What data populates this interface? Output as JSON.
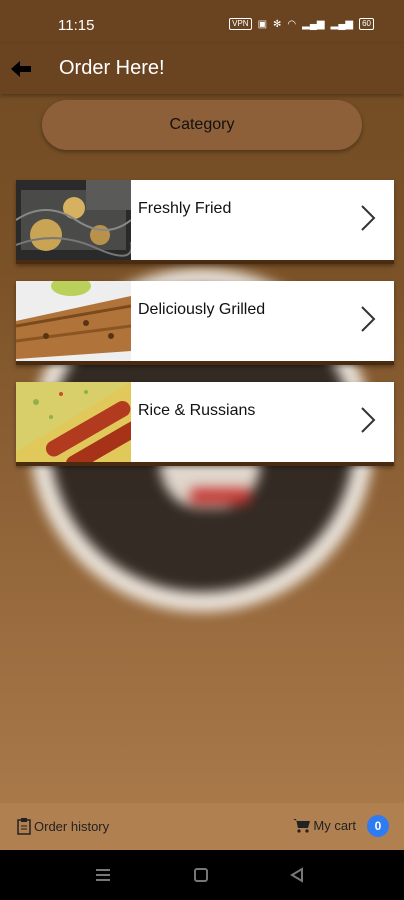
{
  "status_bar": {
    "time": "11:15",
    "vpn": "VPN",
    "battery": "60"
  },
  "app_bar": {
    "title": "Order Here!"
  },
  "category_button": {
    "label": "Category"
  },
  "categories": [
    {
      "label": "Freshly Fried",
      "image": "fryer-food-photo"
    },
    {
      "label": "Deliciously Grilled",
      "image": "grilled-fish-photo"
    },
    {
      "label": "Rice & Russians",
      "image": "rice-sausage-photo"
    }
  ],
  "bottom_bar": {
    "order_history": "Order history",
    "my_cart": "My cart",
    "cart_count": "0"
  },
  "colors": {
    "app_bar": "#6a4320",
    "category_button": "#8e603a",
    "badge": "#2f7bf2",
    "bottom_bar": "#b08050"
  }
}
